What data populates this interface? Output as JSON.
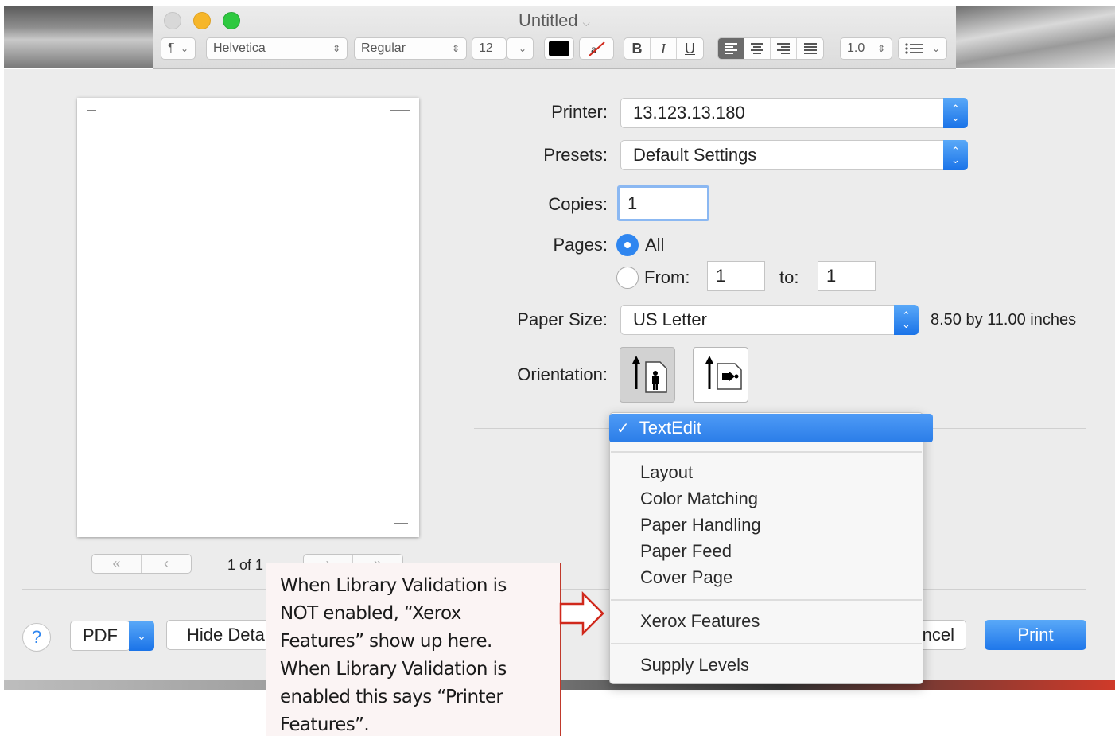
{
  "textedit": {
    "title": "Untitled",
    "paragraph_style": "¶",
    "font_family": "Helvetica",
    "font_style": "Regular",
    "font_size": "12",
    "bold": "B",
    "italic": "I",
    "underline": "U",
    "line_spacing": "1.0",
    "list_icon": "list-icon",
    "text_color": "#000000"
  },
  "print": {
    "printer_label": "Printer:",
    "printer_value": "13.123.13.180",
    "presets_label": "Presets:",
    "presets_value": "Default Settings",
    "copies_label": "Copies:",
    "copies_value": "1",
    "pages_label": "Pages:",
    "pages_all": "All",
    "pages_from_label": "From:",
    "pages_from_value": "1",
    "pages_to_label": "to:",
    "pages_to_value": "1",
    "paper_size_label": "Paper Size:",
    "paper_size_value": "US Letter",
    "paper_dimensions": "8.50 by 11.00 inches",
    "orientation_label": "Orientation:",
    "page_indicator": "1 of 1",
    "help": "?",
    "pdf": "PDF",
    "hide_details": "Hide Details",
    "cancel": "Cancel",
    "print": "Print",
    "accent_color": "#2f86f0"
  },
  "menu": {
    "selected": "TextEdit",
    "checkmark": "✓",
    "items": [
      "Layout",
      "Color Matching",
      "Paper Handling",
      "Paper Feed",
      "Cover Page"
    ],
    "vendor_item": "Xerox Features",
    "last_item": "Supply Levels"
  },
  "annotation": {
    "lines": [
      "When Library Validation is",
      "NOT enabled, “Xerox",
      "Features” show up here.",
      "When Library Validation is",
      "enabled this says “Printer",
      "Features”."
    ],
    "border_color": "#c0392b"
  }
}
